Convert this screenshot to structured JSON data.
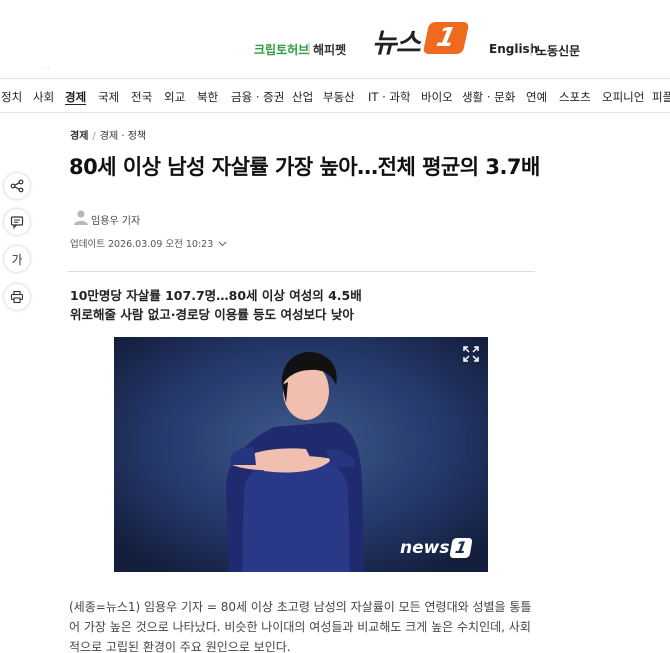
{
  "header": {
    "link_a": "크립토허브",
    "link_b": "해피펫",
    "logo_text": "뉴스",
    "logo_mark": "1",
    "lang_english": "English",
    "lang_labor": "노동신문",
    "separator": "|"
  },
  "nav": {
    "items": [
      "정치",
      "사회",
      "경제",
      "국제",
      "전국",
      "외교",
      "북한",
      "금융 · 증권",
      "산업",
      "부동산",
      "IT · 과학",
      "바이오",
      "생활 · 문화",
      "연예",
      "스포츠",
      "오피니언",
      "피플"
    ],
    "active": "경제"
  },
  "side_tools": {
    "icons": [
      "share-icon",
      "comment-icon",
      "font-size-icon",
      "print-icon"
    ],
    "font_size_label": "가"
  },
  "article": {
    "breadcrumb": [
      "경제",
      "경제 · 정책"
    ],
    "breadcrumb_sep": "/",
    "headline": "80세 이상 남성 자살률 가장 높아…전체 평균의 3.7배",
    "author": "임용우 기자",
    "updated": "업데이트 2026.03.09 오전 10:23",
    "subheads": [
      "10만명당 자살률 107.7명…80세 이상 여성의 4.5배",
      "위로해줄 사람 없고·경로당 이용률 등도 여성보다 낮아"
    ],
    "photo_logo": "news",
    "photo_logo_mark": "1",
    "body": "(세종=뉴스1) 임용우 기자 = 80세 이상 초고령 남성의 자살률이 모든 연령대와 성별을 통틀어 가장 높은 것으로 나타났다. 비슷한 나이대의 여성들과 비교해도 크게 높은 수치인데, 사회적으로 고립된 환경이 주요 원인으로 보인다."
  },
  "colors": {
    "brand_orange": "#ef6a1f",
    "crypto_green": "#2f9a3a",
    "photo_bg": "#1b2b52"
  }
}
